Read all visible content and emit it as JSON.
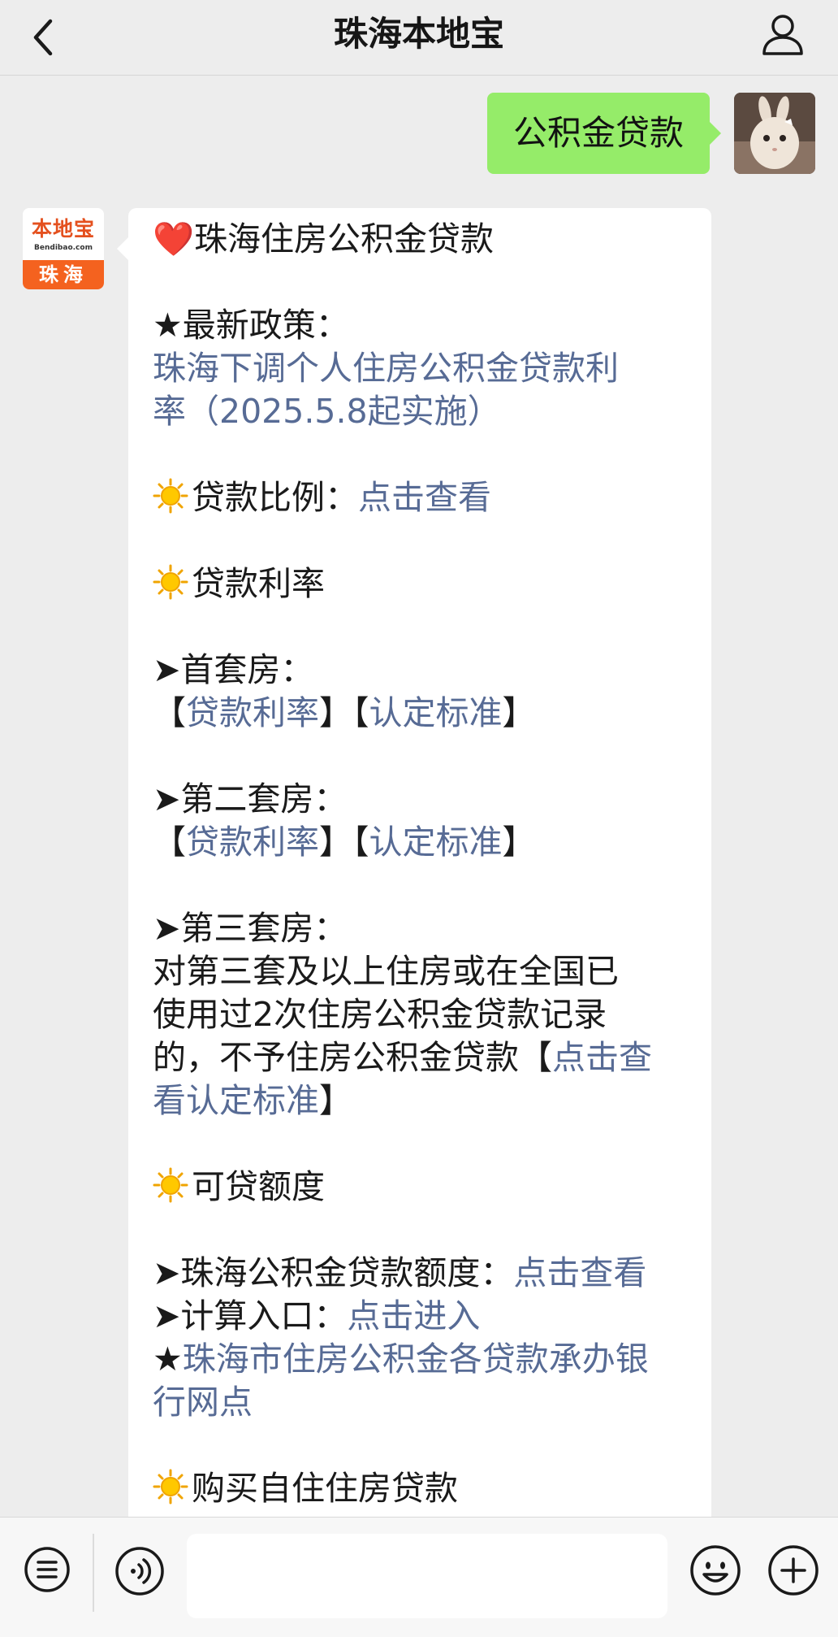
{
  "header": {
    "title": "珠海本地宝",
    "back_icon": "chevron-left-icon",
    "profile_icon": "person-icon"
  },
  "user_message": {
    "text": "公积金贷款"
  },
  "bot_avatar": {
    "brand": "本地宝",
    "domain": "Bendibao.com",
    "city": "珠海"
  },
  "bot_message": {
    "title_prefix": "❤️",
    "title": "珠海住房公积金贷款",
    "policy_label": "★最新政策：",
    "policy_link_line1": "珠海下调个人住房公积金贷款利",
    "policy_link_line2": "率（2025.5.8起实施）",
    "ratio_label": "贷款比例：",
    "ratio_link": "点击查看",
    "rate_label": "贷款利率",
    "first_home_label": "➤首套房：",
    "second_home_label": "➤第二套房：",
    "third_home_label": "➤第三套房：",
    "bracket_open": "【",
    "bracket_close": "】",
    "rate_link": "贷款利率",
    "standard_link": "认定标准",
    "third_text_line1": "对第三套及以上住房或在全国已",
    "third_text_line2": "使用过2次住房公积金贷款记录",
    "third_text_line3": "的，不予住房公积金贷款【",
    "third_link_part1": "点击查",
    "third_link_part2": "看认定标准",
    "amount_label": "可贷额度",
    "amount_item_label": "➤珠海公积金贷款额度：",
    "amount_item_link": "点击查看",
    "calc_label": "➤计算入口：",
    "calc_link": "点击进入",
    "star": "★",
    "bank_link_line1": "珠海市住房公积金各贷款承办银",
    "bank_link_line2": "行网点",
    "purchase_label": "购买自住住房贷款"
  },
  "bottom_bar": {
    "input_value": "",
    "menu_icon": "menu-list-icon",
    "voice_icon": "voice-icon",
    "emoji_icon": "emoji-icon",
    "plus_icon": "plus-circle-icon"
  },
  "colors": {
    "background": "#ededed",
    "user_bubble": "#95ec69",
    "link": "#576b95",
    "brand_orange": "#f4621f"
  }
}
